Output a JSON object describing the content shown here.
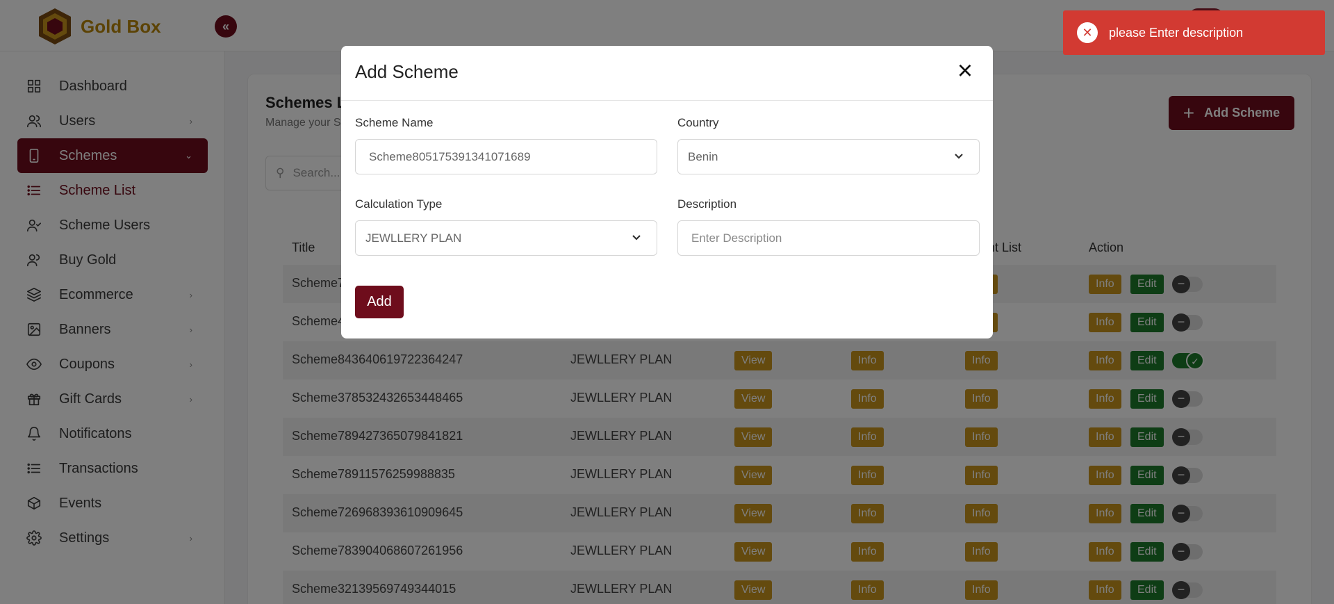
{
  "app": {
    "name": "Gold Box",
    "collapse_icon": "double-chevron-left-icon"
  },
  "colors": {
    "brand": "#6e0d1c",
    "gold": "#c8941c",
    "green": "#1c7a2b",
    "toast": "#d23a32"
  },
  "sidebar": {
    "items": [
      {
        "label": "Dashboard",
        "icon": "grid-icon"
      },
      {
        "label": "Users",
        "icon": "users-icon"
      },
      {
        "label": "Schemes",
        "icon": "phone-icon"
      },
      {
        "label": "Scheme List",
        "icon": "list-icon"
      },
      {
        "label": "Scheme Users",
        "icon": "user-check-icon"
      },
      {
        "label": "Buy Gold",
        "icon": "users-icon"
      },
      {
        "label": "Ecommerce",
        "icon": "layers-icon"
      },
      {
        "label": "Banners",
        "icon": "image-icon"
      },
      {
        "label": "Coupons",
        "icon": "eye-icon"
      },
      {
        "label": "Gift Cards",
        "icon": "gift-icon"
      },
      {
        "label": "Notificatons",
        "icon": "bell-icon"
      },
      {
        "label": "Transactions",
        "icon": "list-icon"
      },
      {
        "label": "Events",
        "icon": "box-icon"
      },
      {
        "label": "Settings",
        "icon": "gear-icon"
      }
    ]
  },
  "main": {
    "title": "Schemes L",
    "subtitle": "Manage your S",
    "search_placeholder": "Search...",
    "add_button": "Add Scheme",
    "columns": {
      "title": "Title",
      "count_list": "unt List",
      "action": "Action"
    },
    "row_labels": {
      "view": "View",
      "info": "Info",
      "edit": "Edit"
    },
    "rows": [
      {
        "title": "Scheme7",
        "type": "",
        "enabled": false
      },
      {
        "title": "Scheme4",
        "type": "",
        "enabled": false
      },
      {
        "title": "Scheme843640619722364247",
        "type": "JEWLLERY PLAN",
        "enabled": true
      },
      {
        "title": "Scheme378532432653448465",
        "type": "JEWLLERY PLAN",
        "enabled": false
      },
      {
        "title": "Scheme789427365079841821",
        "type": "JEWLLERY PLAN",
        "enabled": false
      },
      {
        "title": "Scheme78911576259988835",
        "type": "JEWLLERY PLAN",
        "enabled": false
      },
      {
        "title": "Scheme726968393610909645",
        "type": "JEWLLERY PLAN",
        "enabled": false
      },
      {
        "title": "Scheme783904068607261956",
        "type": "JEWLLERY PLAN",
        "enabled": false
      },
      {
        "title": "Scheme32139569749344015",
        "type": "JEWLLERY PLAN",
        "enabled": false
      }
    ]
  },
  "modal": {
    "title": "Add Scheme",
    "close": "×",
    "scheme_name_label": "Scheme Name",
    "scheme_name_value": "Scheme805175391341071689",
    "country_label": "Country",
    "country_value": "Benin",
    "calc_type_label": "Calculation Type",
    "calc_type_value": "JEWLLERY PLAN",
    "description_label": "Description",
    "description_placeholder": "Enter Description",
    "add_button": "Add"
  },
  "toast": {
    "message": "please Enter description"
  }
}
